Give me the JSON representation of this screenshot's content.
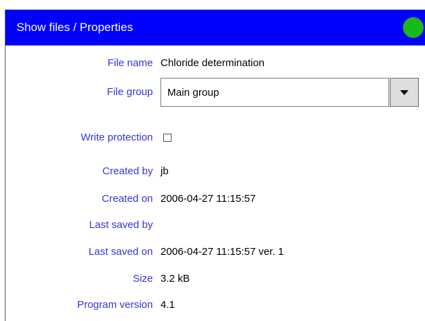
{
  "window": {
    "title": "Show files / Properties",
    "status_color": "#1ab91a",
    "status_icon": "status-indicator-icon"
  },
  "fields": {
    "file_name": {
      "label": "File name",
      "value": "Chloride determination"
    },
    "file_group": {
      "label": "File group",
      "selected": "Main group",
      "button_icon": "dropdown-arrow-icon"
    },
    "write_protection": {
      "label": "Write protection",
      "checked": false
    },
    "created_by": {
      "label": "Created by",
      "value": "jb"
    },
    "created_on": {
      "label": "Created on",
      "value": "2006-04-27 11:15:57"
    },
    "last_saved_by": {
      "label": "Last saved by",
      "value": ""
    },
    "last_saved_on": {
      "label": "Last saved on",
      "value": "2006-04-27 11:15:57 ver. 1"
    },
    "size": {
      "label": "Size",
      "value": "3.2 kB"
    },
    "program_version": {
      "label": "Program version",
      "value": "4.1"
    }
  },
  "colors": {
    "titlebar": "#0000ff",
    "label_text": "#3535d8"
  }
}
